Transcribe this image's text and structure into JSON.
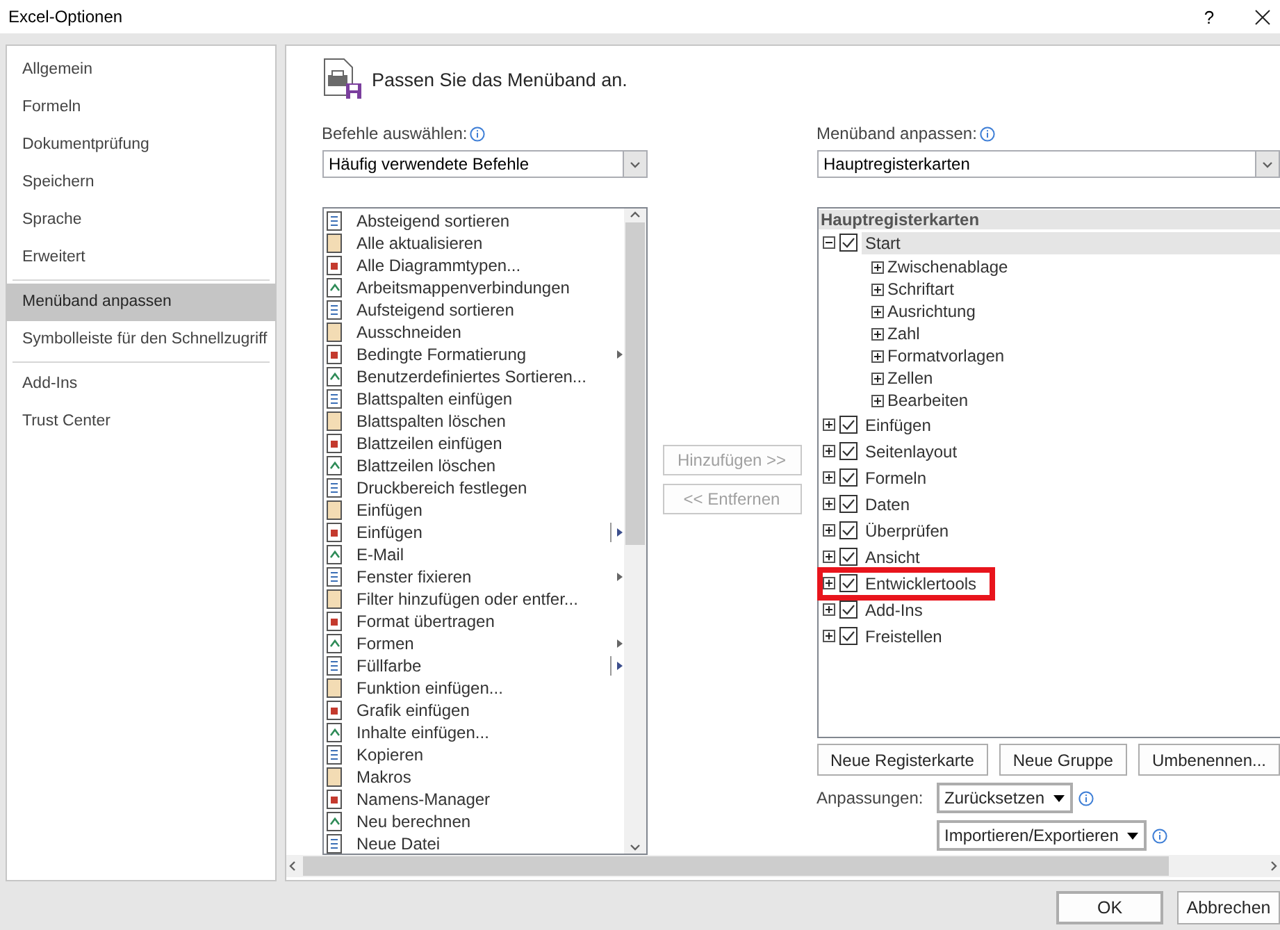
{
  "window": {
    "title": "Excel-Optionen",
    "help": "?"
  },
  "sidebar": {
    "items": [
      {
        "label": "Allgemein",
        "selected": false
      },
      {
        "label": "Formeln",
        "selected": false
      },
      {
        "label": "Dokumentprüfung",
        "selected": false
      },
      {
        "label": "Speichern",
        "selected": false
      },
      {
        "label": "Sprache",
        "selected": false
      },
      {
        "label": "Erweitert",
        "selected": false
      },
      {
        "label": "Menüband anpassen",
        "selected": true
      },
      {
        "label": "Symbolleiste für den Schnellzugriff",
        "selected": false
      },
      {
        "label": "Add-Ins",
        "selected": false
      },
      {
        "label": "Trust Center",
        "selected": false
      }
    ]
  },
  "page_title": "Passen Sie das Menüband an.",
  "commands": {
    "label": "Befehle auswählen:",
    "value": "Häufig verwendete Befehle",
    "items": [
      {
        "label": "Absteigend sortieren",
        "kind": "plain"
      },
      {
        "label": "Alle aktualisieren",
        "kind": "plain"
      },
      {
        "label": "Alle Diagrammtypen...",
        "kind": "plain"
      },
      {
        "label": "Arbeitsmappenverbindungen",
        "kind": "plain"
      },
      {
        "label": "Aufsteigend sortieren",
        "kind": "plain"
      },
      {
        "label": "Ausschneiden",
        "kind": "plain"
      },
      {
        "label": "Bedingte Formatierung",
        "kind": "submenu"
      },
      {
        "label": "Benutzerdefiniertes Sortieren...",
        "kind": "plain"
      },
      {
        "label": "Blattspalten einfügen",
        "kind": "plain"
      },
      {
        "label": "Blattspalten löschen",
        "kind": "plain"
      },
      {
        "label": "Blattzeilen einfügen",
        "kind": "plain"
      },
      {
        "label": "Blattzeilen löschen",
        "kind": "plain"
      },
      {
        "label": "Druckbereich festlegen",
        "kind": "plain"
      },
      {
        "label": "Einfügen",
        "kind": "plain"
      },
      {
        "label": "Einfügen",
        "kind": "split"
      },
      {
        "label": "E-Mail",
        "kind": "plain"
      },
      {
        "label": "Fenster fixieren",
        "kind": "submenu"
      },
      {
        "label": "Filter hinzufügen oder entfer...",
        "kind": "plain"
      },
      {
        "label": "Format übertragen",
        "kind": "plain"
      },
      {
        "label": "Formen",
        "kind": "submenu"
      },
      {
        "label": "Füllfarbe",
        "kind": "split"
      },
      {
        "label": "Funktion einfügen...",
        "kind": "plain"
      },
      {
        "label": "Grafik einfügen",
        "kind": "plain"
      },
      {
        "label": "Inhalte einfügen...",
        "kind": "plain"
      },
      {
        "label": "Kopieren",
        "kind": "plain"
      },
      {
        "label": "Makros",
        "kind": "plain"
      },
      {
        "label": "Namens-Manager",
        "kind": "plain"
      },
      {
        "label": "Neu berechnen",
        "kind": "plain"
      },
      {
        "label": "Neue Datei",
        "kind": "plain"
      }
    ]
  },
  "transfer_buttons": [
    {
      "label": "Hinzufügen >>",
      "disabled": true
    },
    {
      "label": "<< Entfernen",
      "disabled": true
    }
  ],
  "ribbon": {
    "label": "Menüband anpassen:",
    "value": "Hauptregisterkarten",
    "tree_header": "Hauptregisterkarten",
    "tabs": [
      {
        "label": "Start",
        "checked": true,
        "expanded": true,
        "selected": true,
        "highlighted": false,
        "children": [
          {
            "label": "Zwischenablage"
          },
          {
            "label": "Schriftart"
          },
          {
            "label": "Ausrichtung"
          },
          {
            "label": "Zahl"
          },
          {
            "label": "Formatvorlagen"
          },
          {
            "label": "Zellen"
          },
          {
            "label": "Bearbeiten"
          }
        ]
      },
      {
        "label": "Einfügen",
        "checked": true,
        "expanded": false,
        "selected": false,
        "highlighted": false
      },
      {
        "label": "Seitenlayout",
        "checked": true,
        "expanded": false,
        "selected": false,
        "highlighted": false
      },
      {
        "label": "Formeln",
        "checked": true,
        "expanded": false,
        "selected": false,
        "highlighted": false
      },
      {
        "label": "Daten",
        "checked": true,
        "expanded": false,
        "selected": false,
        "highlighted": false
      },
      {
        "label": "Überprüfen",
        "checked": true,
        "expanded": false,
        "selected": false,
        "highlighted": false
      },
      {
        "label": "Ansicht",
        "checked": true,
        "expanded": false,
        "selected": false,
        "highlighted": false
      },
      {
        "label": "Entwicklertools",
        "checked": true,
        "expanded": false,
        "selected": false,
        "highlighted": true
      },
      {
        "label": "Add-Ins",
        "checked": true,
        "expanded": false,
        "selected": false,
        "highlighted": false
      },
      {
        "label": "Freistellen",
        "checked": true,
        "expanded": false,
        "selected": false,
        "highlighted": false
      }
    ],
    "buttons": [
      "Neue Registerkarte",
      "Neue Gruppe",
      "Umbenennen..."
    ],
    "customizations_label": "Anpassungen:",
    "reset": "Zurücksetzen",
    "import_export": "Importieren/Exportieren"
  },
  "footer_buttons": [
    "OK",
    "Abbrechen"
  ]
}
